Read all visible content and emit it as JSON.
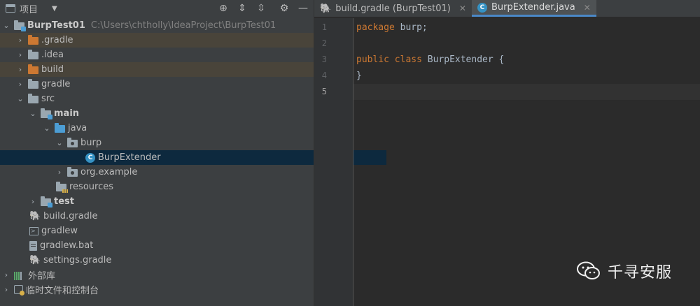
{
  "project_panel": {
    "title": "项目",
    "toolbar_icons": [
      "locate-icon",
      "expand-all-icon",
      "collapse-all-icon",
      "settings-icon",
      "hide-icon"
    ],
    "root": {
      "name": "BurpTest01",
      "path": "C:\\Users\\chtholly\\IdeaProject\\BurpTest01"
    },
    "items": [
      {
        "label": ".gradle"
      },
      {
        "label": ".idea"
      },
      {
        "label": "build"
      },
      {
        "label": "gradle"
      },
      {
        "label": "src"
      },
      {
        "label": "main"
      },
      {
        "label": "java"
      },
      {
        "label": "burp"
      },
      {
        "label": "BurpExtender"
      },
      {
        "label": "org.example"
      },
      {
        "label": "resources"
      },
      {
        "label": "test"
      },
      {
        "label": "build.gradle"
      },
      {
        "label": "gradlew"
      },
      {
        "label": "gradlew.bat"
      },
      {
        "label": "settings.gradle"
      },
      {
        "label": "外部库"
      },
      {
        "label": "临时文件和控制台"
      }
    ]
  },
  "editor": {
    "tabs": [
      {
        "label": "build.gradle (BurpTest01)",
        "active": false
      },
      {
        "label": "BurpExtender.java",
        "active": true
      }
    ],
    "line_numbers": [
      "1",
      "2",
      "3",
      "4",
      "5"
    ],
    "code": {
      "l1_kw": "package",
      "l1_rest": " burp;",
      "l3_kw1": "public",
      "l3_kw2": "class",
      "l3_name": "BurpExtender",
      "l3_brace": " {",
      "l4": "}"
    }
  },
  "watermark": {
    "text": "千寻安服"
  },
  "colors": {
    "keyword": "#cc7832",
    "selection": "#0d293e",
    "highlight": "#49443a",
    "accent": "#4a88c7"
  }
}
